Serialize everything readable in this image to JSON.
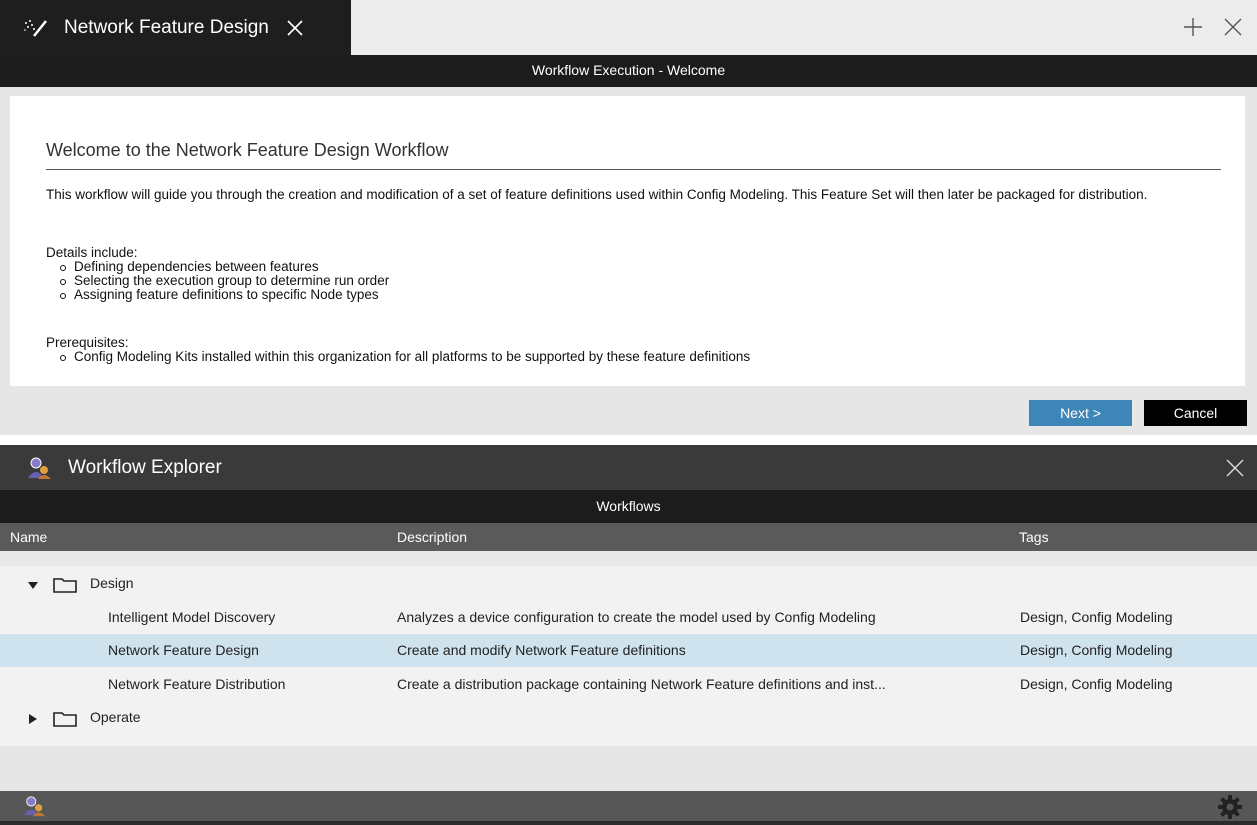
{
  "tab": {
    "title": "Network Feature Design",
    "icon": "magic-wand-icon"
  },
  "exec": {
    "header": "Workflow Execution - Welcome",
    "heading": "Welcome to the Network Feature Design Workflow",
    "intro": "This workflow will guide you through the creation and modification of a set of feature definitions used within Config Modeling. This Feature Set will then later be packaged for distribution.",
    "details_label": "Details include:",
    "details": [
      "Defining dependencies between features",
      "Selecting the execution group to determine run order",
      "Assigning feature definitions to specific Node types"
    ],
    "prereq_label": "Prerequisites:",
    "prereqs": [
      "Config Modeling Kits installed within this organization for all platforms to be supported by these feature definitions"
    ],
    "next_label": "Next >",
    "cancel_label": "Cancel"
  },
  "explorer": {
    "title": "Workflow Explorer",
    "section": "Workflows",
    "columns": {
      "name": "Name",
      "description": "Description",
      "tags": "Tags"
    },
    "folders": [
      {
        "label": "Design",
        "expanded": true
      },
      {
        "label": "Operate",
        "expanded": false
      }
    ],
    "rows": [
      {
        "name": "Intelligent Model Discovery",
        "description": "Analyzes a device configuration to create the model used by Config Modeling",
        "tags": "Design, Config Modeling",
        "selected": false
      },
      {
        "name": "Network Feature Design",
        "description": "Create and modify Network Feature definitions",
        "tags": "Design, Config Modeling",
        "selected": true
      },
      {
        "name": "Network Feature Distribution",
        "description": "Create a distribution package containing Network Feature definitions and inst...",
        "tags": "Design, Config Modeling",
        "selected": false
      }
    ]
  },
  "colors": {
    "accent": "#3f86b8",
    "selected_row": "#cfe3ee",
    "dark_bar": "#1c1c1c"
  }
}
